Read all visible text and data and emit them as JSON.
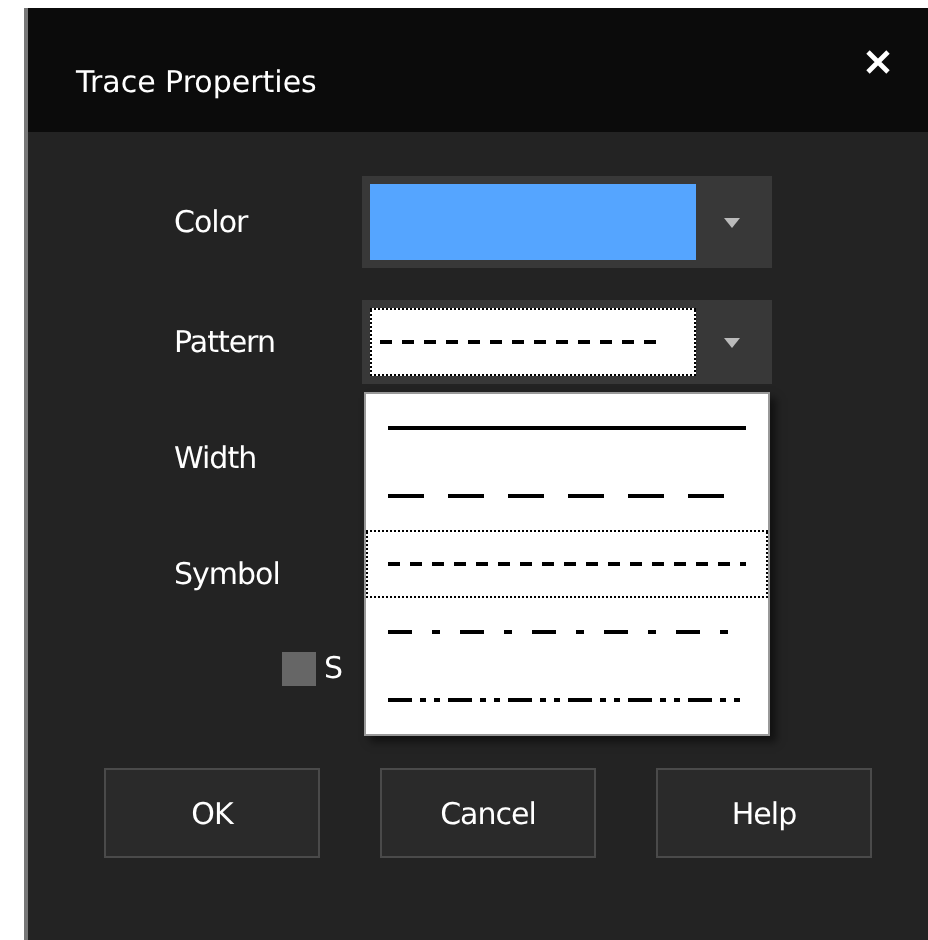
{
  "window": {
    "title": "Trace Properties"
  },
  "fields": [
    {
      "kind": "color",
      "label": "Color",
      "color": "#55a5ff"
    },
    {
      "kind": "pattern",
      "label": "Pattern",
      "line": {
        "kind": "dot"
      }
    },
    {
      "kind": "label",
      "label": "Width"
    },
    {
      "kind": "label",
      "label": "Symbol"
    }
  ],
  "checkbox": {
    "label": "S",
    "checked": false
  },
  "pattern_list": {
    "expanded": true
  },
  "pattern_options": [
    {
      "kind": "solid",
      "selected": false
    },
    {
      "kind": "dash",
      "selected": false
    },
    {
      "kind": "dot",
      "selected": true
    },
    {
      "kind": "dashdot",
      "selected": false
    },
    {
      "kind": "dashdotdot",
      "selected": false
    }
  ],
  "buttons": [
    "OK",
    "Cancel",
    "Help"
  ]
}
